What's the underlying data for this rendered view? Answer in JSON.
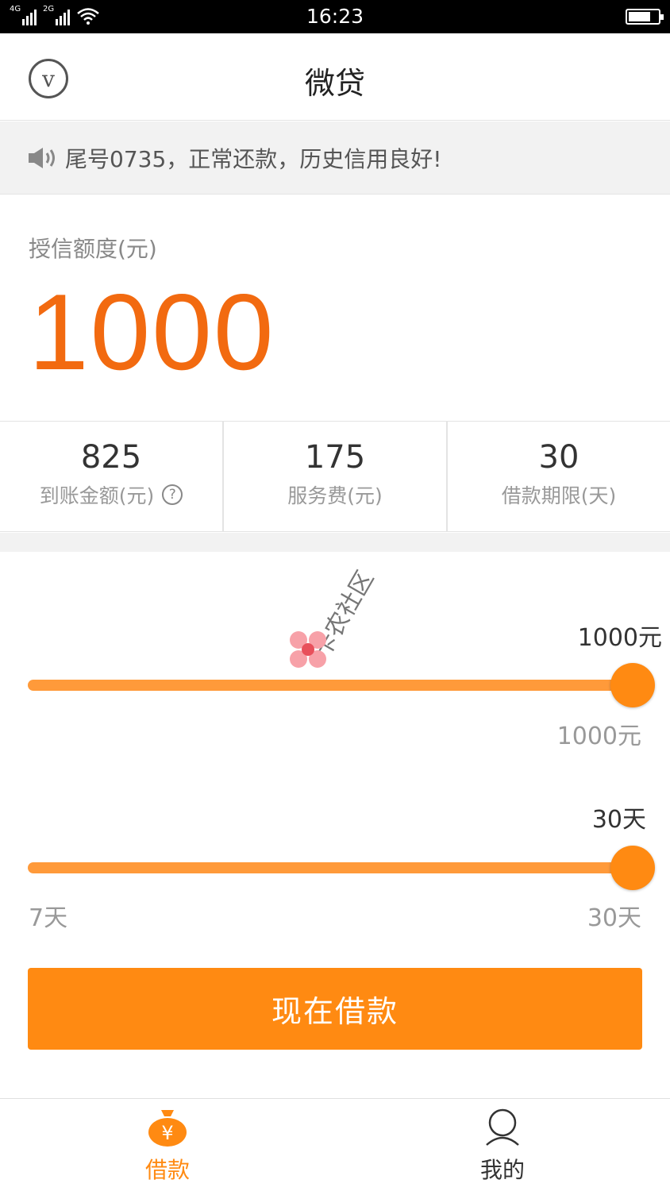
{
  "status_bar": {
    "time": "16:23",
    "network1": "4G",
    "network2": "2G",
    "battery_level": 0.75
  },
  "header": {
    "title": "微贷",
    "logo_letter": "v"
  },
  "notice": {
    "text": "尾号0735，正常还款，历史信用良好!"
  },
  "credit": {
    "label": "授信额度(元)",
    "value": "1000"
  },
  "stats": [
    {
      "value": "825",
      "label": "到账金额(元)",
      "help": "?"
    },
    {
      "value": "175",
      "label": "服务费(元)"
    },
    {
      "value": "30",
      "label": "借款期限(天)"
    }
  ],
  "watermark": {
    "text": "卡农社区"
  },
  "amount_slider": {
    "value_label": "1000元",
    "max_label": "1000元",
    "level": 1.0
  },
  "term_slider": {
    "value_label": "30天",
    "min_label": "7天",
    "max_label": "30天",
    "level": 1.0
  },
  "borrow_button": {
    "label": "现在借款"
  },
  "tabbar": {
    "items": [
      {
        "label": "借款",
        "icon": "money-bag-icon",
        "icon_glyph": "¥",
        "active": true
      },
      {
        "label": "我的",
        "icon": "user-icon",
        "active": false
      }
    ]
  },
  "colors": {
    "accent": "#ff8a12",
    "credit_value": "#f26a10",
    "track": "#ff9a3a"
  }
}
